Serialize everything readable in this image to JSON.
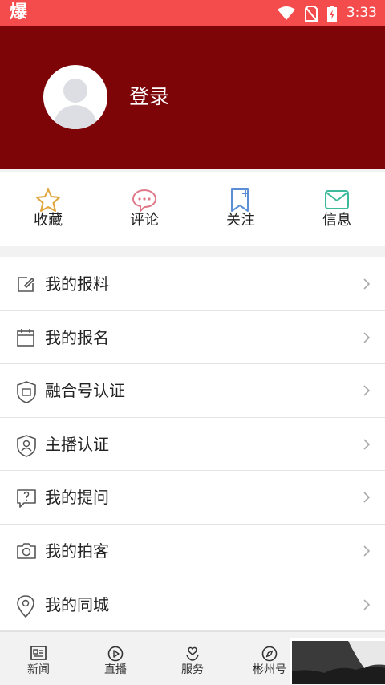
{
  "status_bar": {
    "app_glyph": "爆",
    "time": "3:33",
    "icons": [
      "wifi-icon",
      "no-sim-icon",
      "battery-charging-icon"
    ]
  },
  "profile": {
    "login_label": "登录"
  },
  "quick_actions": [
    {
      "label": "收藏",
      "icon": "star-icon",
      "color": "#e0a43a"
    },
    {
      "label": "评论",
      "icon": "comment-icon",
      "color": "#e07a8a"
    },
    {
      "label": "关注",
      "icon": "bookmark-add-icon",
      "color": "#5a8fd6"
    },
    {
      "label": "信息",
      "icon": "mail-icon",
      "color": "#3bbb9c"
    }
  ],
  "menu_items": [
    {
      "label": "我的报料",
      "icon": "edit-icon"
    },
    {
      "label": "我的报名",
      "icon": "calendar-icon"
    },
    {
      "label": "融合号认证",
      "icon": "shield-badge-icon"
    },
    {
      "label": "主播认证",
      "icon": "shield-user-icon"
    },
    {
      "label": "我的提问",
      "icon": "question-icon"
    },
    {
      "label": "我的拍客",
      "icon": "camera-icon"
    },
    {
      "label": "我的同城",
      "icon": "location-icon"
    }
  ],
  "tabs": [
    {
      "label": "新闻",
      "icon": "news-icon"
    },
    {
      "label": "直播",
      "icon": "live-icon"
    },
    {
      "label": "服务",
      "icon": "service-icon"
    },
    {
      "label": "彬州号",
      "icon": "compass-icon"
    }
  ],
  "colors": {
    "status_bar": "#f44c4c",
    "header": "#7d0507"
  }
}
